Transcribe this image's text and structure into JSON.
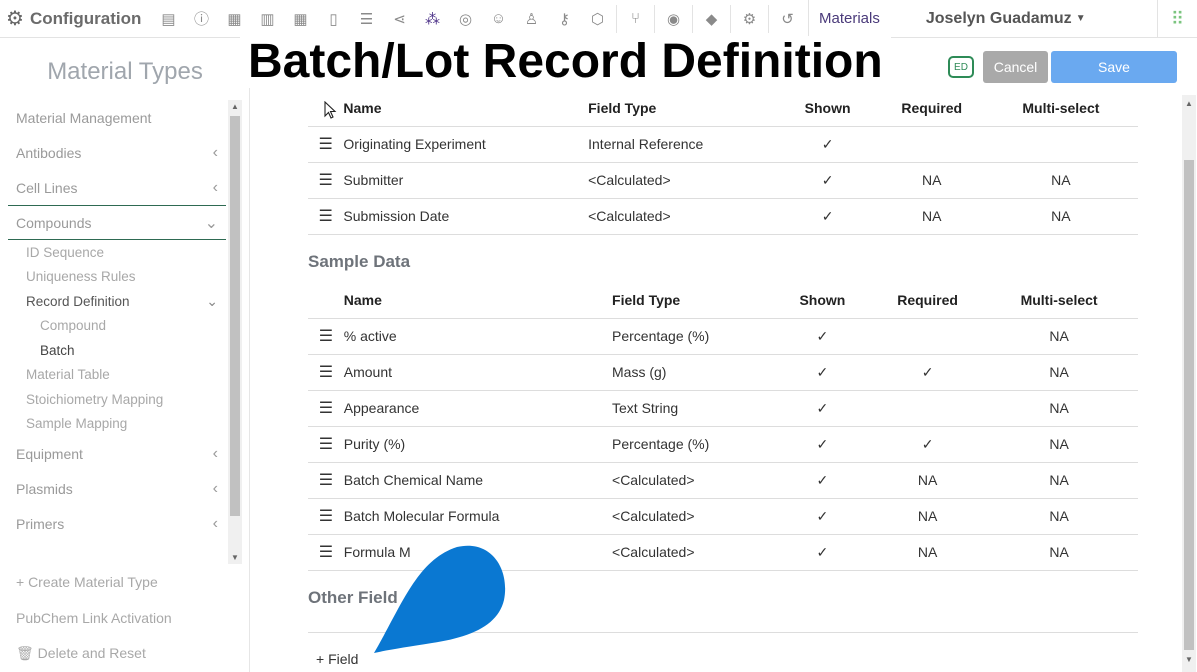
{
  "header": {
    "app_title": "Configuration",
    "section_link": "Materials",
    "user_name": "Joselyn Guadamuz"
  },
  "toolbar_icons": [
    "grid-icon",
    "info-icon",
    "table-icon",
    "notebook-icon",
    "table-alt-icon",
    "document-icon",
    "database-icon",
    "share-icon",
    "molecule-icon",
    "badge-icon",
    "users-icon",
    "user-icon",
    "key-icon",
    "cube-icon",
    "workflow-icon",
    "location-icon",
    "office-icon",
    "gears-icon",
    "history-icon"
  ],
  "overlay_title": "Batch/Lot Record Definition",
  "saved_badge": "ED",
  "buttons": {
    "cancel": "Cancel",
    "save": "Save",
    "add_field": "+ Field"
  },
  "sidebar": {
    "title": "Material Types",
    "items": [
      {
        "label": "Material Management"
      },
      {
        "label": "Antibodies",
        "chevron": "‹"
      },
      {
        "label": "Cell Lines",
        "chevron": "‹"
      },
      {
        "label": "Compounds",
        "chevron": "⌄"
      },
      {
        "label": "ID Sequence"
      },
      {
        "label": "Uniqueness Rules"
      },
      {
        "label": "Record Definition",
        "chevron": "⌄"
      },
      {
        "label": "Compound"
      },
      {
        "label": "Batch"
      },
      {
        "label": "Material Table"
      },
      {
        "label": "Stoichiometry Mapping"
      },
      {
        "label": "Sample Mapping"
      },
      {
        "label": "Equipment",
        "chevron": "‹"
      },
      {
        "label": "Plasmids",
        "chevron": "‹"
      },
      {
        "label": "Primers",
        "chevron": "‹"
      }
    ],
    "create": "+ Create Material Type",
    "pubchem": "PubChem Link Activation",
    "delete": "Delete and Reset"
  },
  "table1": {
    "headers": [
      "Name",
      "Field Type",
      "Shown",
      "Required",
      "Multi-select"
    ],
    "rows": [
      [
        "Originating Experiment",
        "Internal Reference",
        "✓",
        "",
        ""
      ],
      [
        "Submitter",
        "<Calculated>",
        "✓",
        "NA",
        "NA"
      ],
      [
        "Submission Date",
        "<Calculated>",
        "✓",
        "NA",
        "NA"
      ]
    ]
  },
  "sample_data": {
    "heading": "Sample Data",
    "headers": [
      "Name",
      "Field Type",
      "Shown",
      "Required",
      "Multi-select"
    ],
    "rows": [
      [
        "% active",
        "Percentage (%)",
        "✓",
        "",
        "NA"
      ],
      [
        "Amount",
        "Mass (g)",
        "✓",
        "✓",
        "NA"
      ],
      [
        "Appearance",
        "Text String",
        "✓",
        "",
        "NA"
      ],
      [
        "Purity (%)",
        "Percentage (%)",
        "✓",
        "✓",
        "NA"
      ],
      [
        "Batch Chemical Name",
        "<Calculated>",
        "✓",
        "NA",
        "NA"
      ],
      [
        "Batch Molecular Formula",
        "<Calculated>",
        "✓",
        "NA",
        "NA"
      ],
      [
        "Formula M",
        "<Calculated>",
        "✓",
        "NA",
        "NA"
      ]
    ]
  },
  "other_fields": {
    "heading": "Other Field"
  },
  "colors": {
    "accent_green": "#2e6a52",
    "save_blue": "#6aa9f0",
    "cancel_gray": "#a9a9a9",
    "blob_blue": "#0a78d2"
  }
}
